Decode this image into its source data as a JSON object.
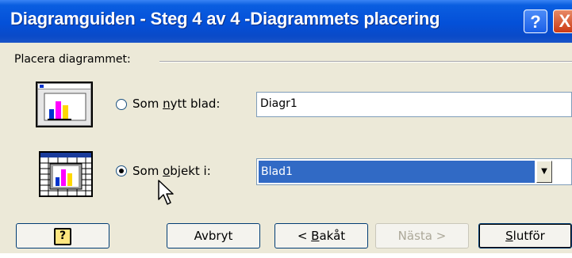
{
  "window": {
    "title": "Diagramguiden - Steg 4 av 4 -Diagrammets placering",
    "help_glyph": "?",
    "close_glyph": "X"
  },
  "group": {
    "label": "Placera diagrammet:"
  },
  "options": [
    {
      "label_prefix": "Som ",
      "label_access": "n",
      "label_suffix": "ytt blad:",
      "selected": false,
      "value": "Diagr1"
    },
    {
      "label_prefix": "Som ",
      "label_access": "o",
      "label_suffix": "bjekt i:",
      "selected": true,
      "value": "Blad1"
    }
  ],
  "buttons": {
    "help_glyph": "?",
    "cancel": "Avbryt",
    "back_prefix": "< ",
    "back_access": "B",
    "back_suffix": "akåt",
    "next": "Nästa >",
    "finish_access": "S",
    "finish_suffix": "lutför"
  },
  "colors": {
    "titlebar": "#0450d8",
    "selection": "#316ac5",
    "dialog_bg": "#ece9d8",
    "chart_yellow": "#ffd800",
    "chart_magenta": "#ff00ff",
    "chart_blue": "#0033cc"
  },
  "icons": [
    "help-icon",
    "close-icon",
    "new-sheet-chart-icon",
    "embedded-object-chart-icon",
    "dropdown-arrow-icon",
    "mouse-pointer-icon"
  ]
}
